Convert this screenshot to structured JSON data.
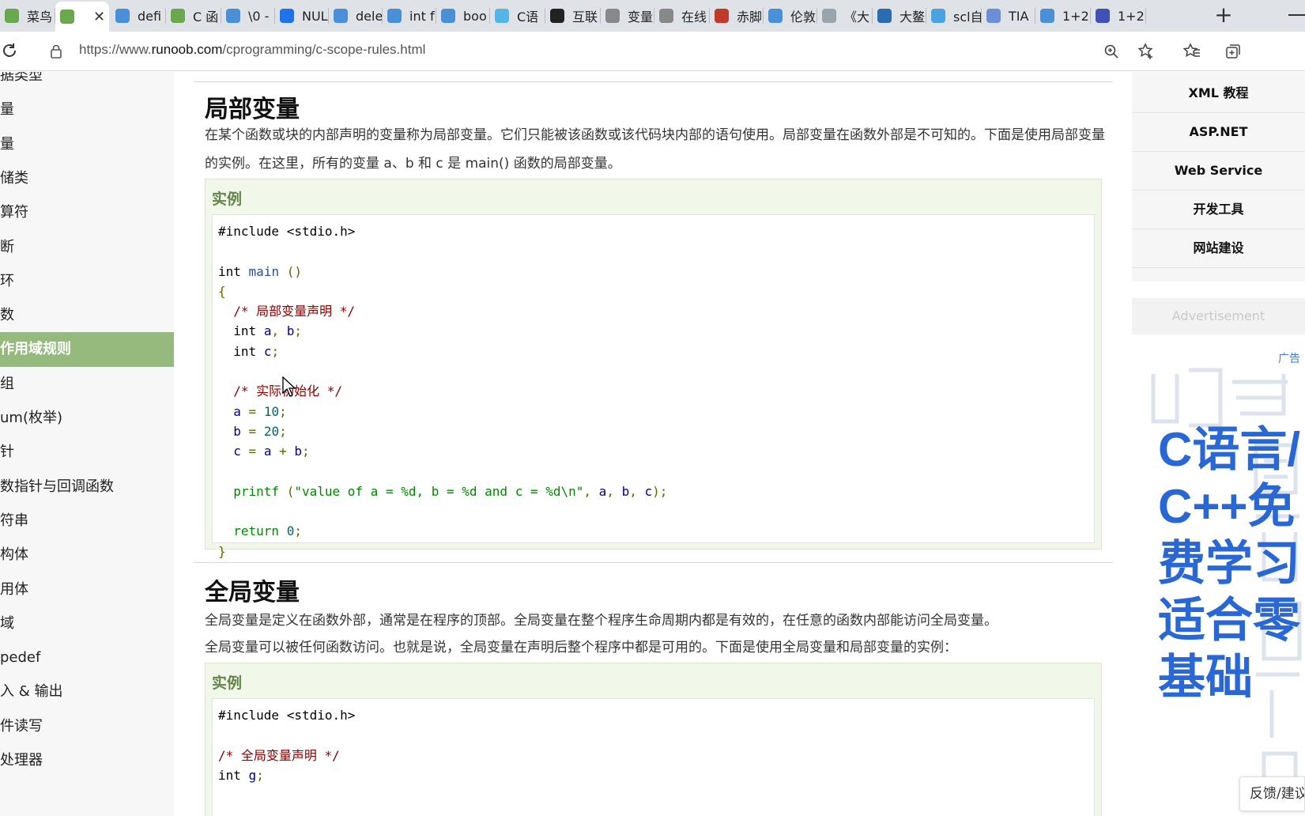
{
  "browser": {
    "tabs": [
      {
        "label": "菜鸟",
        "icon": "runoob-icon",
        "color": "#6aa84f"
      },
      {
        "label": "",
        "icon": "runoob-icon",
        "color": "#6aa84f",
        "active": true
      },
      {
        "label": "defi",
        "icon": "bing-icon",
        "color": "#4a90d9"
      },
      {
        "label": "C 函",
        "icon": "runoob-icon",
        "color": "#6aa84f"
      },
      {
        "label": "\\0 -",
        "icon": "bing-icon",
        "color": "#4a90d9"
      },
      {
        "label": "NUL",
        "icon": "zhihu-icon",
        "color": "#1e73e8"
      },
      {
        "label": "dele",
        "icon": "bing-icon",
        "color": "#4a90d9"
      },
      {
        "label": "int f",
        "icon": "bing-icon",
        "color": "#4a90d9"
      },
      {
        "label": "boo",
        "icon": "bing-icon",
        "color": "#4a90d9"
      },
      {
        "label": "C语",
        "icon": "bilibili-icon",
        "color": "#55b5e6"
      },
      {
        "label": "互联",
        "icon": "c-icon",
        "color": "#222222"
      },
      {
        "label": "变量",
        "icon": "c-icon",
        "color": "#888888"
      },
      {
        "label": "在线",
        "icon": "c-icon",
        "color": "#888888"
      },
      {
        "label": "赤脚",
        "icon": "pdf-icon",
        "color": "#c0392b"
      },
      {
        "label": "伦敦",
        "icon": "bing-icon",
        "color": "#4a90d9"
      },
      {
        "label": "《大",
        "icon": "circle-icon",
        "color": "#9aa4ad"
      },
      {
        "label": "大鳌",
        "icon": "eye-icon",
        "color": "#2b6cb0"
      },
      {
        "label": "scl自",
        "icon": "shield-icon",
        "color": "#4aa3df"
      },
      {
        "label": "TIA",
        "icon": "cloud-icon",
        "color": "#6b8fd6"
      },
      {
        "label": "1+2",
        "icon": "bing-icon",
        "color": "#4a90d9"
      },
      {
        "label": "1+2",
        "icon": "paw-icon",
        "color": "#3f51b5"
      }
    ],
    "close_glyph": "✕",
    "new_tab_glyph": "+",
    "url_prefix": "https://www.",
    "url_domain": "runoob.com",
    "url_path": "/cprogramming/c-scope-rules.html"
  },
  "sidebar": {
    "items": [
      {
        "label": "据类型"
      },
      {
        "label": "量"
      },
      {
        "label": "量"
      },
      {
        "label": "储类"
      },
      {
        "label": "算符"
      },
      {
        "label": "断"
      },
      {
        "label": "环"
      },
      {
        "label": "数"
      },
      {
        "label": "作用域规则",
        "active": true
      },
      {
        "label": "组"
      },
      {
        "label": "um(枚举)"
      },
      {
        "label": "针"
      },
      {
        "label": "数指针与回调函数"
      },
      {
        "label": "符串"
      },
      {
        "label": "构体"
      },
      {
        "label": "用体"
      },
      {
        "label": "域"
      },
      {
        "label": "pedef"
      },
      {
        "label": "入 & 输出"
      },
      {
        "label": "件读写"
      },
      {
        "label": "处理器"
      }
    ],
    "active_color": "#96b97d"
  },
  "content": {
    "local_heading": "局部变量",
    "local_para": "在某个函数或块的内部声明的变量称为局部变量。它们只能被该函数或该代码块内部的语句使用。局部变量在函数外部是不可知的。下面是使用局部变量的实例。在这里，所有的变量 a、b 和 c 是 main() 函数的局部变量。",
    "example_title": "实例",
    "code1": [
      "#include <stdio.h>",
      "",
      "int main ()",
      "{",
      "  /* 局部变量声明 */",
      "  int a, b;",
      "  int c;",
      "",
      "  /* 实际初始化 */",
      "  a = 10;",
      "  b = 20;",
      "  c = a + b;",
      "",
      "  printf (\"value of a = %d, b = %d and c = %d\\n\", a, b, c);",
      "",
      "  return 0;",
      "}"
    ],
    "global_heading": "全局变量",
    "global_para1": "全局变量是定义在函数外部，通常是在程序的顶部。全局变量在整个程序生命周期内都是有效的，在任意的函数内部能访问全局变量。",
    "global_para2": "全局变量可以被任何函数访问。也就是说，全局变量在声明后整个程序中都是可用的。下面是使用全局变量和局部变量的实例：",
    "example2_title": "实例",
    "code2": [
      "#include <stdio.h>",
      "",
      "/* 全局变量声明 */",
      "int g;"
    ]
  },
  "right_nav": {
    "items": [
      "XML 教程",
      "ASP.NET",
      "Web Service",
      "开发工具",
      "网站建设"
    ],
    "ad_label": "Advertisement",
    "ad_tag": "广告",
    "ad_text": "C语言/C++免费学习适合零基础",
    "feedback": "反馈/建议"
  },
  "colors": {
    "accent_green": "#96b97d",
    "example_title_green": "#64854c",
    "ad_blue": "#2867d4"
  }
}
